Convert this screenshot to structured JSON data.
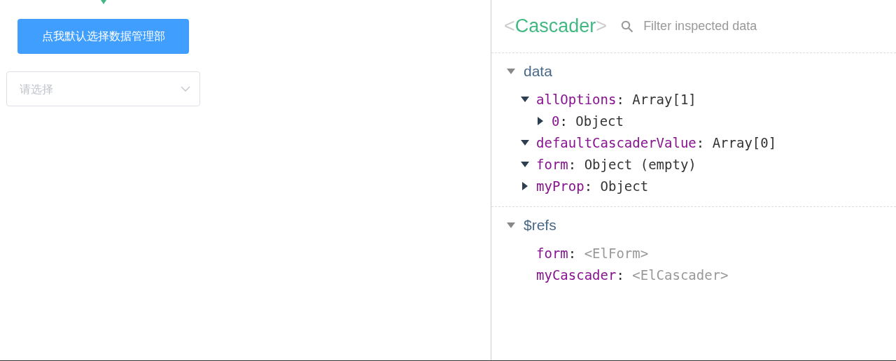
{
  "app": {
    "button": "点我默认选择数据管理部",
    "cascader": {
      "placeholder": "请选择",
      "expanded": false
    }
  },
  "inspector": {
    "component": {
      "open": "<",
      "name": "Cascader",
      "close": ">"
    },
    "filter": {
      "placeholder": "Filter inspected data"
    },
    "sections": [
      {
        "title": "data",
        "expanded": true,
        "items": [
          {
            "key": "allOptions",
            "colon": ":",
            "value": "Array[1]",
            "kind": "value",
            "expanded": true,
            "children": [
              {
                "key": "0",
                "colon": ":",
                "value": "Object",
                "kind": "value",
                "expanded": false
              }
            ]
          },
          {
            "key": "defaultCascaderValue",
            "colon": ":",
            "value": "Array[0]",
            "kind": "value",
            "expanded": true
          },
          {
            "key": "form",
            "colon": ":",
            "value": "Object (empty)",
            "kind": "value",
            "expanded": true
          },
          {
            "key": "myProp",
            "colon": ":",
            "value": "Object",
            "kind": "value",
            "expanded": false
          }
        ]
      },
      {
        "title": "$refs",
        "expanded": true,
        "items": [
          {
            "key": "form",
            "colon": ":",
            "value": "<ElForm>",
            "kind": "ref"
          },
          {
            "key": "myCascader",
            "colon": ":",
            "value": "<ElCascader>",
            "kind": "ref"
          }
        ]
      }
    ]
  }
}
